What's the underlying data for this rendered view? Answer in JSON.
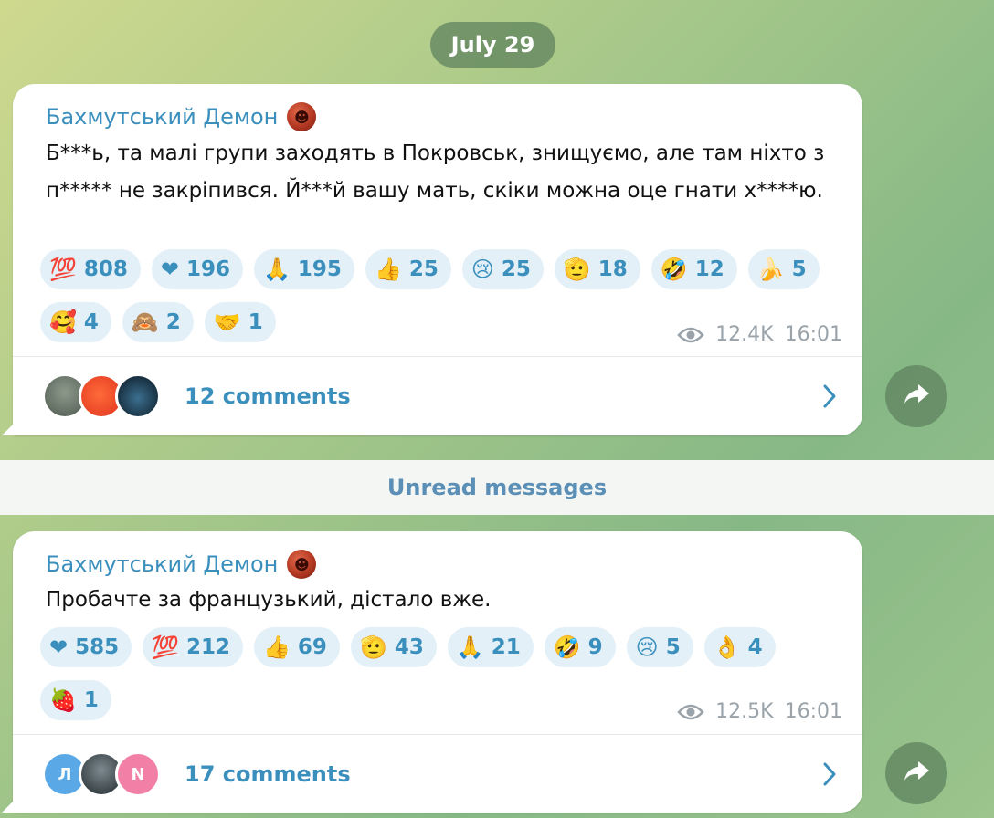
{
  "date_separator": "July 29",
  "unread_label": "Unread messages",
  "messages": [
    {
      "sender": "Бахмутський Демон",
      "text": "Б***ь, та малі групи заходять в Покровськ, знищуємо, але там ніхто з п***** не закріпився. Й***й вашу мать, скіки можна оце гнати х****ю.",
      "reactions": [
        {
          "icon": "hundred-points-icon",
          "emoji": "💯",
          "count": "808"
        },
        {
          "icon": "heart-icon",
          "emoji": "❤",
          "count": "196"
        },
        {
          "icon": "folded-hands-icon",
          "emoji": "🙏",
          "count": "195"
        },
        {
          "icon": "thumbs-up-icon",
          "emoji": "👍",
          "count": "25"
        },
        {
          "icon": "crying-face-icon",
          "emoji": "😢",
          "count": "25"
        },
        {
          "icon": "salute-icon",
          "emoji": "🫡",
          "count": "18"
        },
        {
          "icon": "rofl-face-icon",
          "emoji": "🤣",
          "count": "12"
        },
        {
          "icon": "banana-icon",
          "emoji": "🍌",
          "count": "5"
        },
        {
          "icon": "smiling-hearts-icon",
          "emoji": "🥰",
          "count": "4"
        },
        {
          "icon": "see-no-evil-monkey-icon",
          "emoji": "🙈",
          "count": "2"
        },
        {
          "icon": "handshake-icon",
          "emoji": "🤝",
          "count": "1"
        }
      ],
      "views": "12.4K",
      "time": "16:01",
      "comments": "12 comments"
    },
    {
      "sender": "Бахмутський Демон",
      "text": "Пробачте за французький, дістало вже.",
      "reactions": [
        {
          "icon": "heart-icon",
          "emoji": "❤",
          "count": "585"
        },
        {
          "icon": "hundred-points-icon",
          "emoji": "💯",
          "count": "212"
        },
        {
          "icon": "thumbs-up-icon",
          "emoji": "👍",
          "count": "69"
        },
        {
          "icon": "salute-icon",
          "emoji": "🫡",
          "count": "43"
        },
        {
          "icon": "folded-hands-icon",
          "emoji": "🙏",
          "count": "21"
        },
        {
          "icon": "rofl-face-icon",
          "emoji": "🤣",
          "count": "9"
        },
        {
          "icon": "crying-face-icon",
          "emoji": "😢",
          "count": "5"
        },
        {
          "icon": "ok-hand-icon",
          "emoji": "👌",
          "count": "4"
        },
        {
          "icon": "strawberry-icon",
          "emoji": "🍓",
          "count": "1"
        }
      ],
      "views": "12.5K",
      "time": "16:01",
      "comments": "17 comments",
      "avatar_letters": [
        "Л",
        "",
        "N"
      ]
    }
  ],
  "colors": {
    "link_blue": "#3a8fbd",
    "reaction_bg": "#e3f0f8",
    "meta_gray": "#9aa3a9",
    "date_pill_bg": "#5c805c"
  }
}
